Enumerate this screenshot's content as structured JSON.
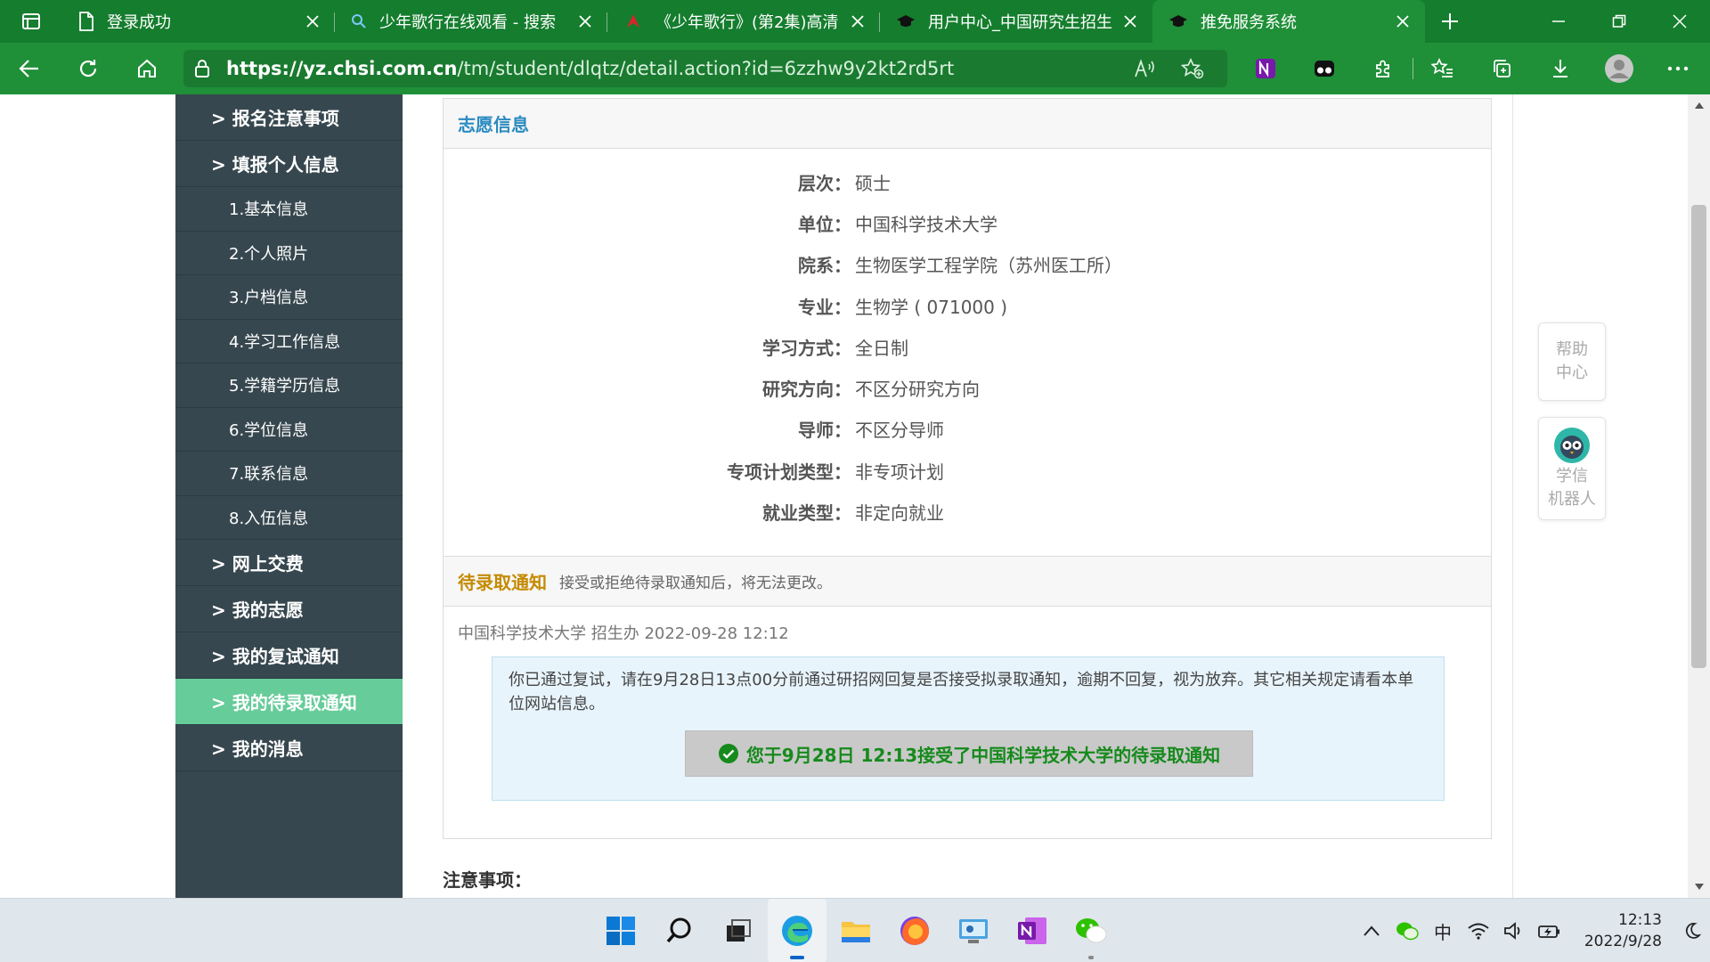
{
  "browser": {
    "tabs": [
      {
        "title": "登录成功",
        "icon": "page-icon"
      },
      {
        "title": "少年歌行在线观看 - 搜索",
        "icon": "search-icon"
      },
      {
        "title": "《少年歌行》(第2集)高清",
        "icon": "site-logo-icon"
      },
      {
        "title": "用户中心_中国研究生招生",
        "icon": "mortarboard-icon"
      },
      {
        "title": "推免服务系统",
        "icon": "mortarboard-icon",
        "active": true
      }
    ],
    "url_host": "https://yz.chsi.com.cn",
    "url_path": "/tm/student/dlqtz/detail.action?id=6zzhw9y2kt2rd5rt"
  },
  "sidebar": {
    "items": [
      {
        "label": "> 报名注意事项",
        "type": "main"
      },
      {
        "label": "> 填报个人信息",
        "type": "main"
      },
      {
        "label": "1.基本信息",
        "type": "sub"
      },
      {
        "label": "2.个人照片",
        "type": "sub"
      },
      {
        "label": "3.户档信息",
        "type": "sub"
      },
      {
        "label": "4.学习工作信息",
        "type": "sub"
      },
      {
        "label": "5.学籍学历信息",
        "type": "sub"
      },
      {
        "label": "6.学位信息",
        "type": "sub"
      },
      {
        "label": "7.联系信息",
        "type": "sub"
      },
      {
        "label": "8.入伍信息",
        "type": "sub"
      },
      {
        "label": "> 网上交费",
        "type": "main"
      },
      {
        "label": "> 我的志愿",
        "type": "main"
      },
      {
        "label": "> 我的复试通知",
        "type": "main"
      },
      {
        "label": "> 我的待录取通知",
        "type": "main",
        "active": true
      },
      {
        "label": "> 我的消息",
        "type": "main"
      }
    ]
  },
  "volunteer": {
    "title": "志愿信息",
    "rows": [
      {
        "label": "层次：",
        "value": "硕士"
      },
      {
        "label": "单位：",
        "value": "中国科学技术大学"
      },
      {
        "label": "院系：",
        "value": "生物医学工程学院（苏州医工所）"
      },
      {
        "label": "专业：",
        "value": "生物学 ( 071000 )"
      },
      {
        "label": "学习方式：",
        "value": "全日制"
      },
      {
        "label": "研究方向：",
        "value": "不区分研究方向"
      },
      {
        "label": "导师：",
        "value": "不区分导师"
      },
      {
        "label": "专项计划类型：",
        "value": "非专项计划"
      },
      {
        "label": "就业类型：",
        "value": "非定向就业"
      }
    ]
  },
  "notice": {
    "title": "待录取通知",
    "hint": "接受或拒绝待录取通知后，将无法更改。",
    "meta": "中国科学技术大学 招生办 2022-09-28 12:12",
    "message": "你已通过复试，请在9月28日13点00分前通过研招网回复是否接受拟录取通知，逾期不回复，视为放弃。其它相关规定请看本单位网站信息。",
    "accepted": "您于9月28日 12:13接受了中国科学技术大学的待录取通知"
  },
  "notes_title": "注意事项：",
  "float": {
    "help_line1": "帮助",
    "help_line2": "中心",
    "robot_line1": "学信",
    "robot_line2": "机器人"
  },
  "taskbar": {
    "ime": "中",
    "time": "12:13",
    "date": "2022/9/28"
  },
  "colors": {
    "browser_green": "#1f8f38",
    "sidebar": "#37474f",
    "sidebar_active": "#66cc99",
    "title_blue": "#2b8bc0",
    "notice_gold": "#c58a00",
    "accept_green": "#168a1c"
  }
}
